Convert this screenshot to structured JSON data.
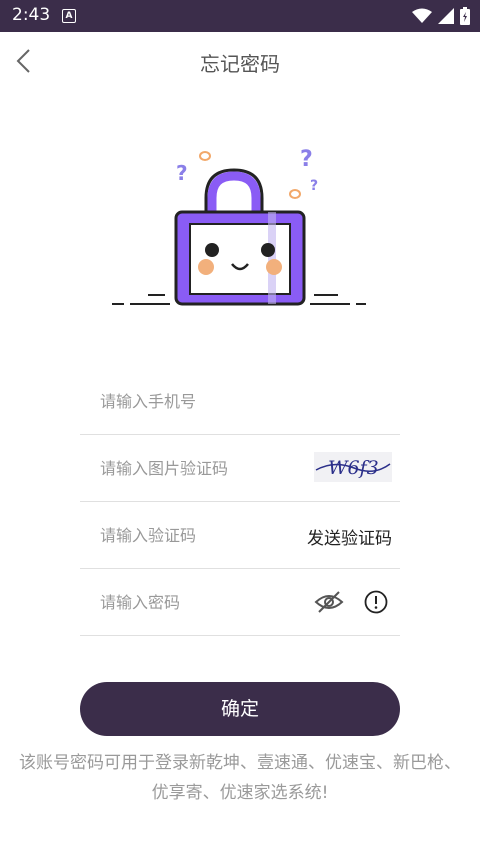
{
  "status_bar": {
    "time": "2:43",
    "a_icon": "A"
  },
  "header": {
    "title": "忘记密码"
  },
  "form": {
    "phone_placeholder": "请输入手机号",
    "image_code_placeholder": "请输入图片验证码",
    "captcha_text": "W6f3",
    "sms_code_placeholder": "请输入验证码",
    "send_code_label": "发送验证码",
    "password_placeholder": "请输入密码"
  },
  "confirm_label": "确定",
  "note": "该账号密码可用于登录新乾坤、壹速通、优速宝、新巴枪、优享寄、优速家选系统!",
  "colors": {
    "primary": "#3b2d4a",
    "accent": "#8a5cf5"
  }
}
